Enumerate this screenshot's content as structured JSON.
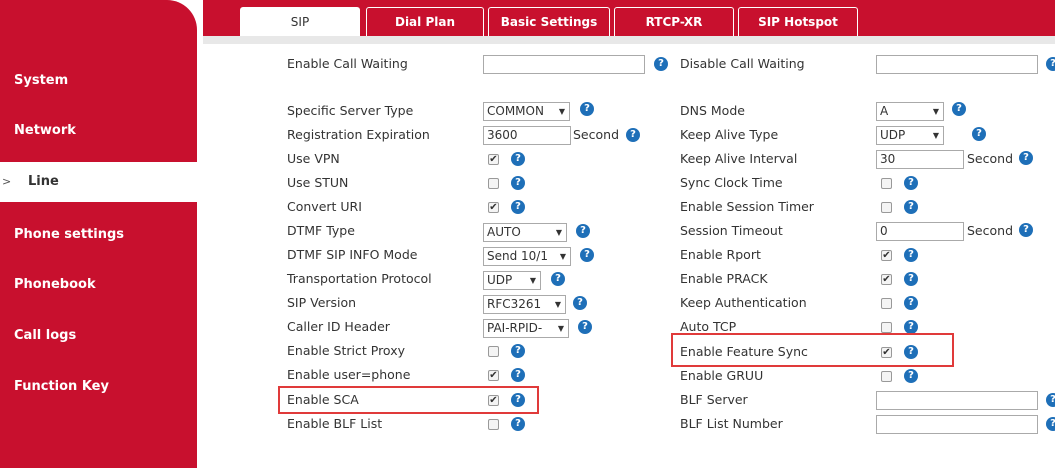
{
  "sidebar": {
    "items": [
      {
        "label": "System"
      },
      {
        "label": "Network"
      },
      {
        "label": "Line"
      },
      {
        "label": "Phone settings"
      },
      {
        "label": "Phonebook"
      },
      {
        "label": "Call logs"
      },
      {
        "label": "Function Key"
      }
    ],
    "active_caret": ">"
  },
  "tabs": [
    {
      "label": "SIP"
    },
    {
      "label": "Dial Plan"
    },
    {
      "label": "Basic Settings"
    },
    {
      "label": "RTCP-XR"
    },
    {
      "label": "SIP Hotspot"
    }
  ],
  "left": {
    "enable_call_waiting": "Enable Call Waiting",
    "specific_server_type": {
      "label": "Specific Server Type",
      "value": "COMMON"
    },
    "registration_expiration": {
      "label": "Registration Expiration",
      "value": "3600",
      "unit": "Second"
    },
    "use_vpn": {
      "label": "Use VPN",
      "checked": true
    },
    "use_stun": {
      "label": "Use STUN",
      "checked": false
    },
    "convert_uri": {
      "label": "Convert URI",
      "checked": true
    },
    "dtmf_type": {
      "label": "DTMF Type",
      "value": "AUTO"
    },
    "dtmf_sip_info_mode": {
      "label": "DTMF SIP INFO Mode",
      "value": "Send 10/1"
    },
    "transportation_protocol": {
      "label": "Transportation Protocol",
      "value": "UDP"
    },
    "sip_version": {
      "label": "SIP Version",
      "value": "RFC3261"
    },
    "caller_id_header": {
      "label": "Caller ID Header",
      "value": "PAI-RPID-"
    },
    "enable_strict_proxy": {
      "label": "Enable Strict Proxy",
      "checked": false
    },
    "enable_user_phone": {
      "label": "Enable user=phone",
      "checked": true
    },
    "enable_sca": {
      "label": "Enable SCA",
      "checked": true
    },
    "enable_blf_list": {
      "label": "Enable BLF List",
      "checked": false
    }
  },
  "right": {
    "disable_call_waiting": "Disable Call Waiting",
    "dns_mode": {
      "label": "DNS Mode",
      "value": "A"
    },
    "keep_alive_type": {
      "label": "Keep Alive Type",
      "value": "UDP"
    },
    "keep_alive_interval": {
      "label": "Keep Alive Interval",
      "value": "30",
      "unit": "Second"
    },
    "sync_clock_time": {
      "label": "Sync Clock Time",
      "checked": false
    },
    "enable_session_timer": {
      "label": "Enable Session Timer",
      "checked": false
    },
    "session_timeout": {
      "label": "Session Timeout",
      "value": "0",
      "unit": "Second"
    },
    "enable_rport": {
      "label": "Enable Rport",
      "checked": true
    },
    "enable_prack": {
      "label": "Enable PRACK",
      "checked": true
    },
    "keep_authentication": {
      "label": "Keep Authentication",
      "checked": false
    },
    "auto_tcp": {
      "label": "Auto TCP",
      "checked": false
    },
    "enable_feature_sync": {
      "label": "Enable Feature Sync",
      "checked": true
    },
    "enable_gruu": {
      "label": "Enable GRUU",
      "checked": false
    },
    "blf_server": "BLF Server",
    "blf_list_number": "BLF List Number"
  },
  "glyphs": {
    "help": "?",
    "check": "✔",
    "arrow": "▼"
  },
  "colors": {
    "brand_red": "#c8102e",
    "help_blue": "#1e6fb8",
    "highlight_red": "#e03a3a"
  }
}
